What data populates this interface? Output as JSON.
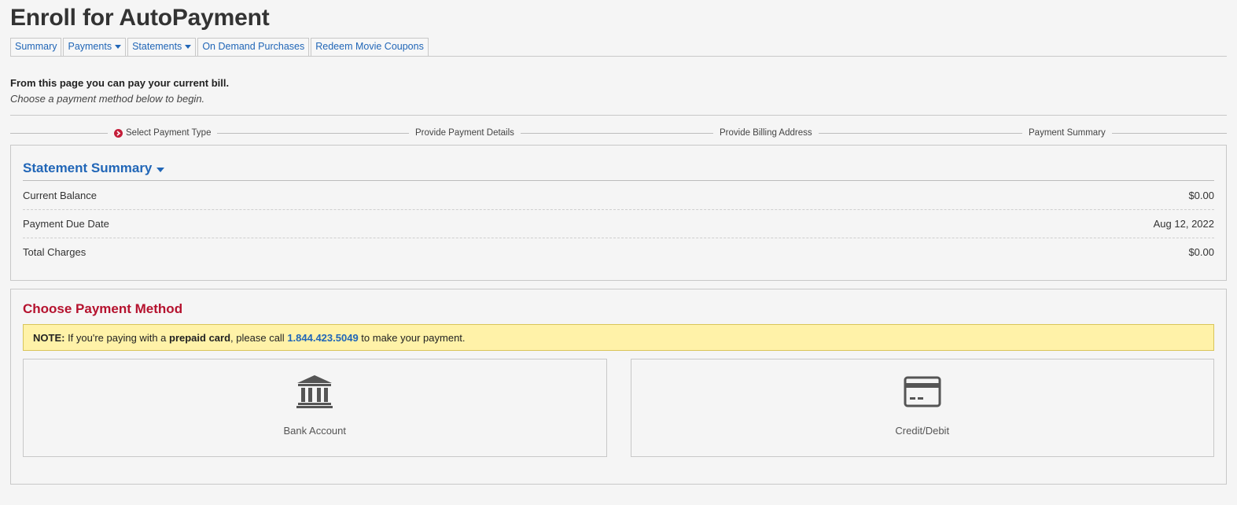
{
  "page": {
    "title": "Enroll for AutoPayment"
  },
  "tabs": [
    {
      "label": "Summary",
      "dropdown": false
    },
    {
      "label": "Payments",
      "dropdown": true
    },
    {
      "label": "Statements",
      "dropdown": true
    },
    {
      "label": "On Demand Purchases",
      "dropdown": false
    },
    {
      "label": "Redeem Movie Coupons",
      "dropdown": false
    }
  ],
  "intro": {
    "line1": "From this page you can pay your current bill.",
    "line2": "Choose a payment method below to begin."
  },
  "steps": [
    {
      "label": "Select Payment Type",
      "active": true,
      "icon": "chevron-right-circle-icon"
    },
    {
      "label": "Provide Payment Details",
      "active": false
    },
    {
      "label": "Provide Billing Address",
      "active": false
    },
    {
      "label": "Payment Summary",
      "active": false
    }
  ],
  "statement_summary": {
    "title": "Statement Summary",
    "rows": [
      {
        "label": "Current Balance",
        "value": "$0.00"
      },
      {
        "label": "Payment Due Date",
        "value": "Aug 12, 2022"
      },
      {
        "label": "Total Charges",
        "value": "$0.00"
      }
    ]
  },
  "payment_method": {
    "title": "Choose Payment Method",
    "note": {
      "prefix": "NOTE:",
      "text1": " If you're paying with a ",
      "emphasis": "prepaid card",
      "text2": ", please call ",
      "phone": "1.844.423.5049",
      "text3": " to make your payment."
    },
    "options": [
      {
        "label": "Bank Account",
        "icon": "bank-icon"
      },
      {
        "label": "Credit/Debit",
        "icon": "credit-card-icon"
      }
    ]
  },
  "colors": {
    "link": "#2166b7",
    "accent_red": "#b5122e",
    "note_bg": "#fff2a8",
    "background": "#f5f5f5"
  }
}
